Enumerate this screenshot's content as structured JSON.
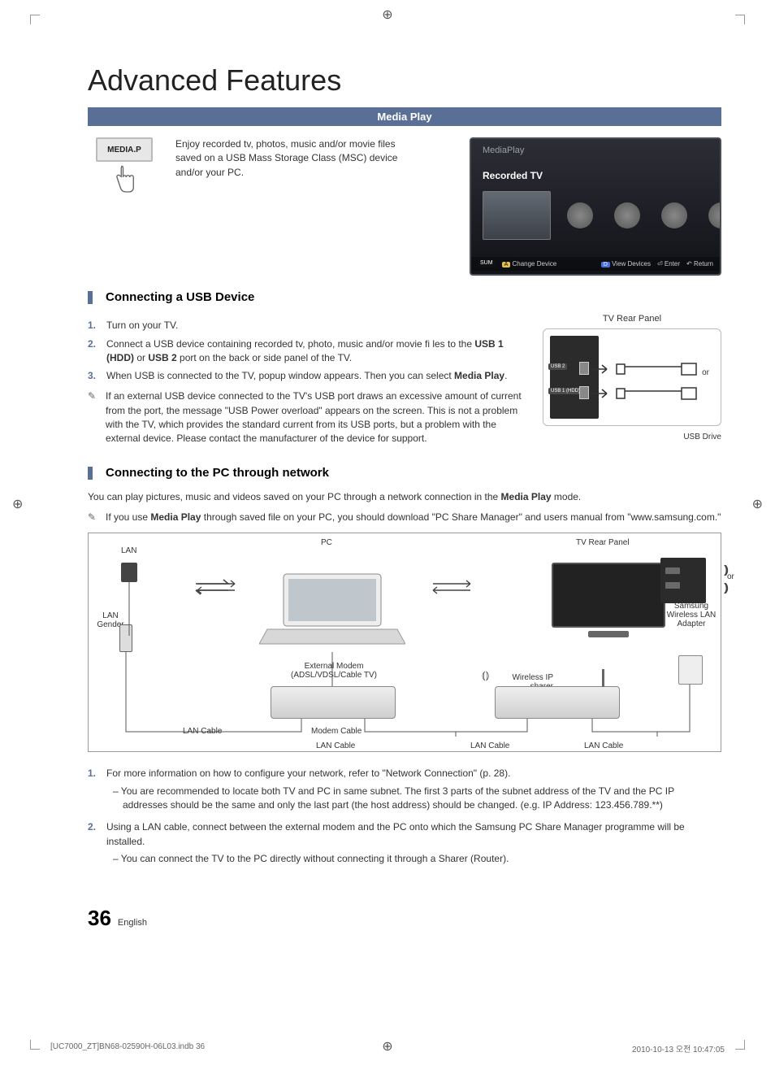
{
  "page_title": "Advanced Features",
  "section_header": "Media Play",
  "remote_button": "MEDIA.P",
  "intro_text": "Enjoy recorded tv, photos, music and/or movie files saved on a USB Mass Storage Class (MSC) device and/or your PC.",
  "osd": {
    "title": "MediaPlay",
    "subtitle": "Recorded TV",
    "footer": {
      "sum": "SUM",
      "change": "Change Device",
      "view": "View Devices",
      "enter": "Enter",
      "return": "Return"
    }
  },
  "usb_section": {
    "heading": "Connecting a USB Device",
    "steps": [
      "Turn on your TV.",
      "Connect a USB device containing recorded tv, photo, music and/or movie fi les to the USB 1 (HDD) or USB 2 port on the back or side panel of the TV.",
      "When USB is connected to the TV, popup window appears. Then you can select Media Play."
    ],
    "bold_in_step2a": "USB 1 (HDD)",
    "bold_in_step2b": "USB 2",
    "bold_in_step3": "Media Play",
    "note": "If an external USB device connected to the TV's USB port draws an excessive amount of current from the port, the message \"USB Power overload\" appears on the screen. This is not a problem with the TV, which provides the standard current from its USB ports, but a problem with the external device. Please contact the manufacturer of the device for support.",
    "rear_panel_label": "TV Rear Panel",
    "usb2_label": "USB 2",
    "usb1_label": "USB 1 (HDD)",
    "or_label": "or",
    "drive_label": "USB Drive"
  },
  "pc_section": {
    "heading": "Connecting to the PC through network",
    "intro": "You can play pictures, music and videos saved on your PC through a network connection in the Media Play mode.",
    "intro_bold": "Media Play",
    "note": "If you use Media Play through saved file on your PC, you should download \"PC Share Manager\" and users manual from \"www.samsung.com.\"",
    "note_bold": "Media Play",
    "diagram": {
      "lan": "LAN",
      "lan_gender": "LAN Gender",
      "pc": "PC",
      "external_modem": "External Modem",
      "external_modem_sub": "(ADSL/VDSL/Cable TV)",
      "modem_cable": "Modem Cable",
      "lan_cable": "LAN Cable",
      "wireless_sharer": "Wireless IP sharer",
      "tv_rear": "TV Rear Panel",
      "or": "or",
      "wireless_adapter": "Samsung Wireless LAN Adapter"
    },
    "final_steps": {
      "s1": "For more information on how to configure your network, refer to \"Network Connection\" (p. 28).",
      "s1_sub": "You are recommended to locate both TV and PC in same subnet. The first 3 parts of the subnet address of the TV and the PC IP addresses should be the same and only the last part (the host address) should be changed. (e.g. IP Address: 123.456.789.**)",
      "s2": "Using a LAN cable, connect between the external modem and the PC onto which the Samsung PC Share Manager programme will be installed.",
      "s2_sub": "You can connect the TV to the PC directly without connecting it through a Sharer (Router)."
    }
  },
  "footer": {
    "page_number": "36",
    "language": "English",
    "print_left": "[UC7000_ZT]BN68-02590H-06L03.indb   36",
    "print_right": "2010-10-13   오전 10:47:05"
  }
}
